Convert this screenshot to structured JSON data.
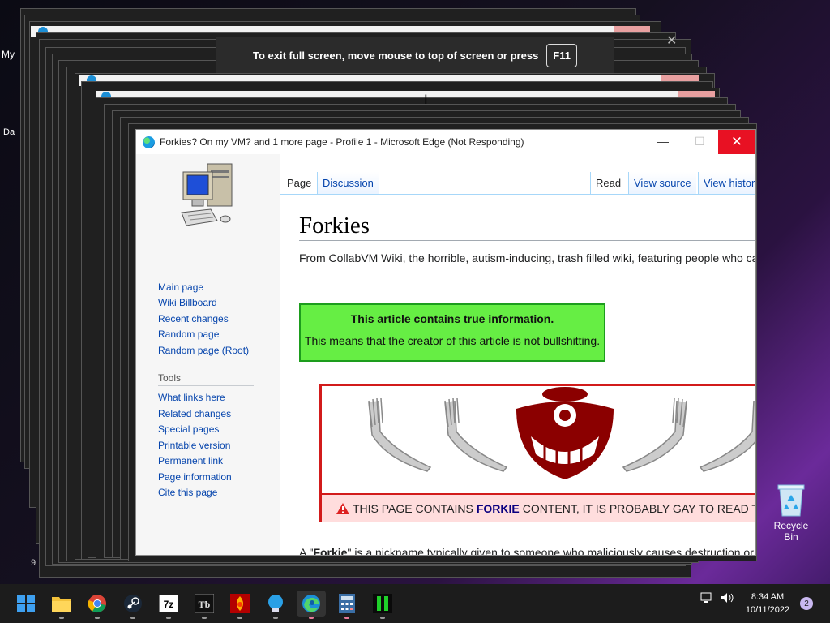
{
  "desktop": {
    "labels": [
      "My",
      "Da",
      "9"
    ],
    "recycle_bin": "Recycle Bin"
  },
  "fullscreen_banner": {
    "message": "To exit full screen, move mouse to top of screen or press",
    "key": "F11"
  },
  "window": {
    "title": "Forkies? On my VM? and 1 more page - Profile 1 - Microsoft Edge (Not Responding)",
    "minimize": "—",
    "maximize": "☐",
    "close": "✕"
  },
  "sidebar": {
    "nav": [
      "Main page",
      "Wiki Billboard",
      "Recent changes",
      "Random page",
      "Random page (Root)"
    ],
    "tools_heading": "Tools",
    "tools": [
      "What links here",
      "Related changes",
      "Special pages",
      "Printable version",
      "Permanent link",
      "Page information",
      "Cite this page"
    ]
  },
  "tabs": {
    "page": "Page",
    "discussion": "Discussion",
    "read": "Read",
    "view_source": "View source",
    "view_history": "View histor"
  },
  "article": {
    "title": "Forkies",
    "tagline": "From CollabVM Wiki, the horrible, autism-inducing, trash filled wiki, featuring people who ca",
    "green_box_title": "This article contains true information.",
    "green_box_text": "This means that the creator of this article is not bullshitting.",
    "warning_prefix": "THIS PAGE CONTAINS",
    "warning_bold": "FORKIE",
    "warning_suffix": "CONTENT, IT IS PROBABLY GAY TO READ T",
    "body_start": "A \"",
    "body_bold": "Forkie",
    "body_rest": "\" is a nickname typically given to someone who maliciously causes destruction or"
  },
  "taskbar": {
    "apps": [
      "start-icon",
      "file-explorer-icon",
      "chrome-icon",
      "steam-icon",
      "7zip-icon",
      "tb-app-icon",
      "fireworks-icon",
      "lightbulb-icon",
      "edge-icon",
      "calculator-icon",
      "terminal-icon"
    ],
    "time": "8:34 AM",
    "date": "10/11/2022",
    "notification_count": "2"
  }
}
